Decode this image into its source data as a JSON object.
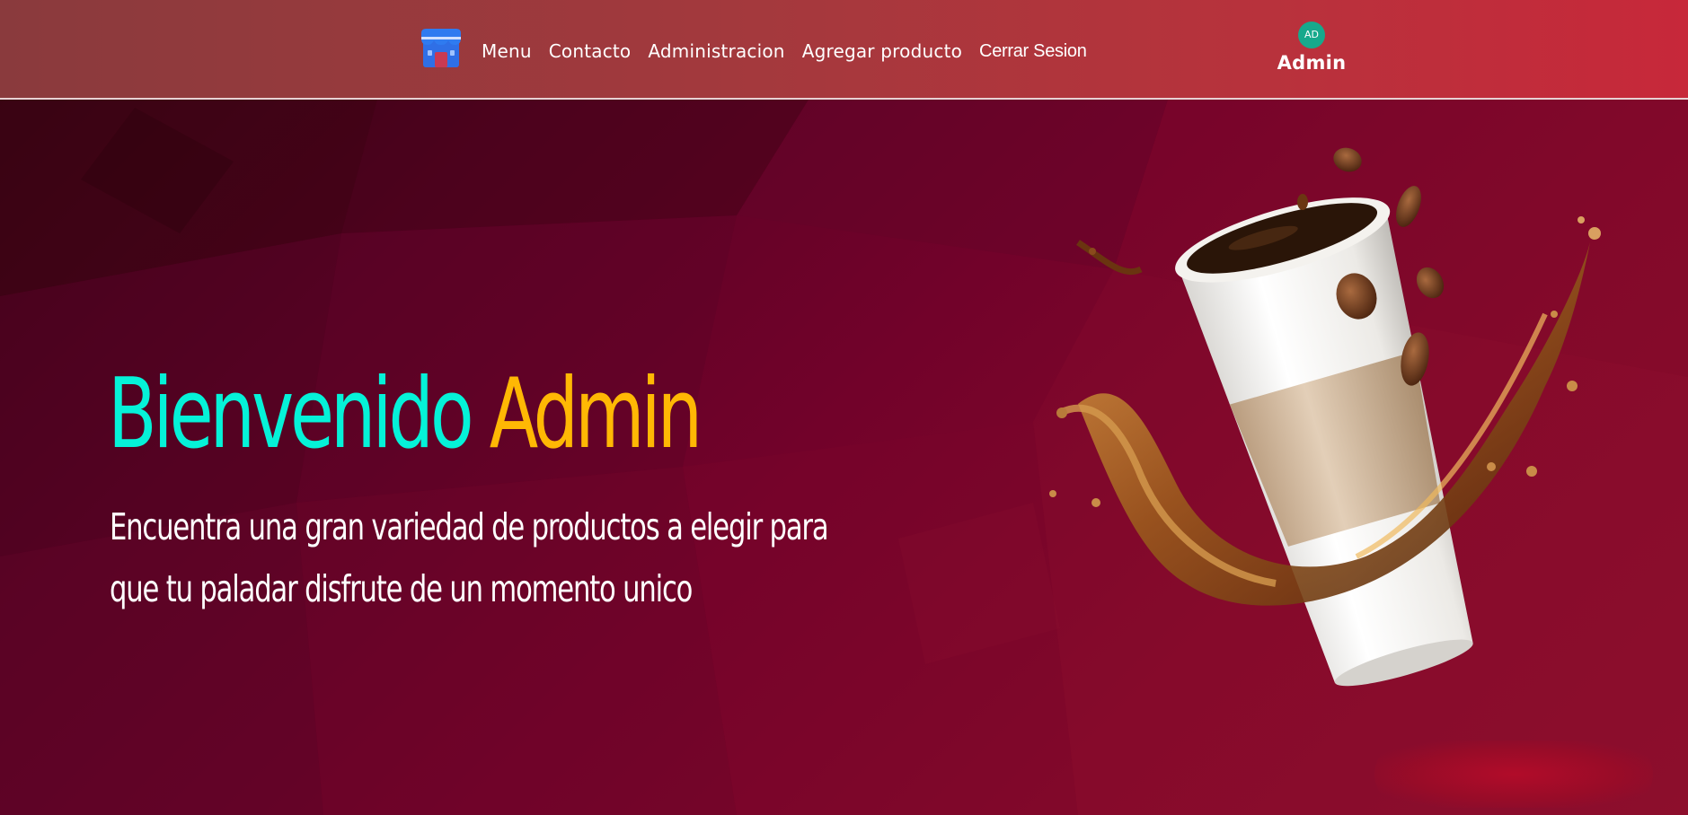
{
  "header": {
    "logo_icon": "store-icon",
    "nav": [
      {
        "label": "Menu"
      },
      {
        "label": "Contacto"
      },
      {
        "label": "Administracion"
      },
      {
        "label": "Agregar producto"
      },
      {
        "label": "Cerrar Sesion"
      }
    ],
    "user": {
      "initials": "AD",
      "name": "Admin"
    }
  },
  "hero": {
    "title_word_1": "Bienvenido",
    "title_word_2": "Admin",
    "subtitle_line_1": "Encuentra una gran variedad de productos a elegir para",
    "subtitle_line_2": "que tu paladar disfrute de un momento unico",
    "image_icon": "coffee-cup-splash-image"
  },
  "colors": {
    "accent_cyan": "#05f2d8",
    "accent_amber": "#ffb804",
    "avatar_bg": "#17a98c",
    "background": "#72022a",
    "header_bg": "#a4393d"
  }
}
